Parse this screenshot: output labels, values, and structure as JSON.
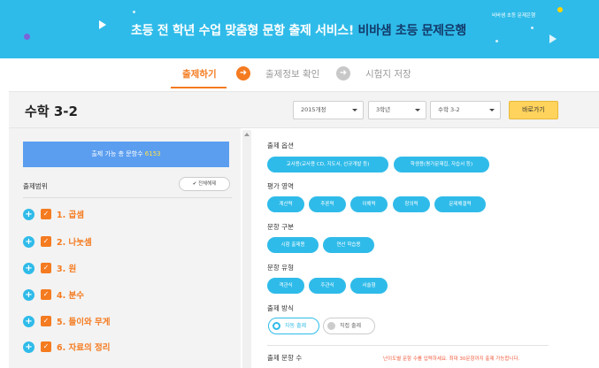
{
  "banner": {
    "title_prefix": "초등 전 학년 수업 맞춤형 문항 출제 서비스!",
    "title_highlight": "비바샘 초등 문제은행",
    "tag": "비바샘 초등 문제은행"
  },
  "steps": [
    {
      "label": "출제하기",
      "active": true
    },
    {
      "label": "출제정보 확인",
      "active": false
    },
    {
      "label": "시험지 저장",
      "active": false
    }
  ],
  "subject": {
    "title": "수학 3-2",
    "selects": [
      "2015개정",
      "3학년",
      "수학 3-2"
    ],
    "go_label": "바로가기"
  },
  "left": {
    "count_prefix": "출제 가능 총 문항수",
    "count_value": "6153",
    "scope_label": "출제범위",
    "clear_label": "전체해제",
    "units": [
      "1. 곱셈",
      "2. 나눗셈",
      "3. 원",
      "4. 분수",
      "5. 들이와 무게",
      "6. 자료의 정리"
    ]
  },
  "right": {
    "options_label": "출제 옵션",
    "option_pills": [
      "교사용(교사용 CD, 지도서, 선규개발 등)",
      "학생용(평가문제집, 자습서 등)"
    ],
    "area_label": "평가 영역",
    "area_pills": [
      "계산력",
      "추론력",
      "이해력",
      "창의력",
      "문제해결력"
    ],
    "type_label": "문항 구분",
    "type_pills": [
      "시험 출제용",
      "연산 학습용"
    ],
    "kind_label": "문항 유형",
    "kind_pills": [
      "객관식",
      "주관식",
      "서술형"
    ],
    "method_label": "출제 방식",
    "method_auto": "자동 출제",
    "method_manual": "직접 출제",
    "count_label": "출제 문항 수",
    "count_note": "난이도별 문항 수를 입력하세요. 최대 30문항까지 출제 가능합니다."
  },
  "colors": {
    "banner": "#2fbbe9",
    "accent_orange": "#f47b20",
    "accent_blue": "#2fbbe9",
    "count_box": "#5b9ef0",
    "go_button": "#ffd35c"
  }
}
